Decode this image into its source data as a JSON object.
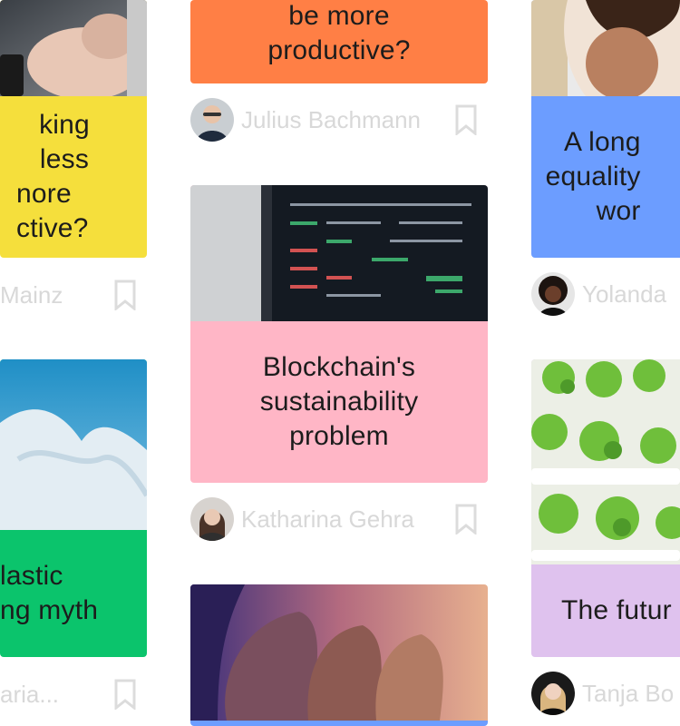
{
  "colors": {
    "orange": "#ff7f45",
    "yellow": "#f5df3c",
    "blue": "#6c9dff",
    "pink": "#ffb6c6",
    "green": "#0bc46c",
    "lilac": "#dfc2ee",
    "author_text": "#d8d8d8",
    "bookmark": "#dcdcdc"
  },
  "cards": [
    {
      "title_lines": [
        "be more",
        "productive?"
      ],
      "color": "orange",
      "author": "Julius Bachmann",
      "avatar_icon": "person-avatar-icon",
      "bookmark_icon": "bookmark-icon"
    },
    {
      "title_lines": [
        "king less",
        "nore",
        "ctive?"
      ],
      "color": "yellow",
      "author": "Mainz",
      "image_icon": "smartphone-hands-image",
      "bookmark_icon": "bookmark-icon"
    },
    {
      "title_lines": [
        "A long",
        "equality",
        "wor"
      ],
      "color": "blue",
      "author": "Yolanda",
      "image_icon": "woman-portrait-image",
      "avatar_icon": "person-avatar-icon"
    },
    {
      "title_lines": [
        "Blockchain's",
        "sustainability",
        "problem"
      ],
      "color": "pink",
      "author": "Katharina Gehra",
      "image_icon": "trading-screen-image",
      "avatar_icon": "person-avatar-icon",
      "bookmark_icon": "bookmark-icon"
    },
    {
      "title_lines": [
        "lastic",
        "ng myth"
      ],
      "color": "green",
      "author": "aria...",
      "image_icon": "plastic-bag-image",
      "bookmark_icon": "bookmark-icon"
    },
    {
      "title_lines": [
        "The futur"
      ],
      "color": "lilac",
      "author": "Tanja Bo",
      "image_icon": "hydroponic-lettuce-image",
      "avatar_icon": "person-avatar-icon"
    },
    {
      "title_lines": [],
      "color": "blue",
      "image_icon": "women-faces-image"
    }
  ]
}
